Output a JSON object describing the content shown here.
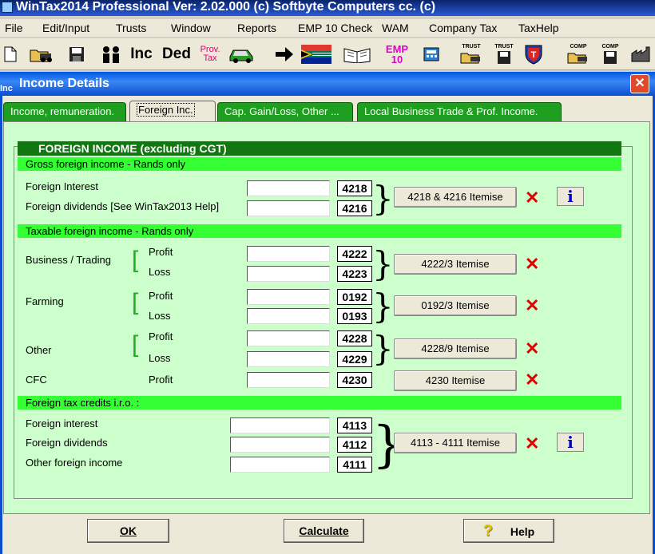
{
  "app": {
    "title": "WinTax2014 Professional Ver: 2.02.000  (c) Softbyte Computers cc.  (c)"
  },
  "menu": [
    "File",
    "Edit/Input",
    "Trusts",
    "Window",
    "Reports",
    "EMP 10 Check",
    "WAM",
    "Company Tax",
    "TaxHelp"
  ],
  "toolbar": {
    "inc_label": "Inc",
    "ded_label": "Ded",
    "prov_label": "Prov.",
    "tax_label": "Tax",
    "emp_label": "EMP",
    "emp_num": "10",
    "trust_label": "TRUST",
    "comp_label": "COMP"
  },
  "dialog": {
    "icon_text": "Inc",
    "title": "Income Details",
    "close_symbol": "✕"
  },
  "tabs": [
    "Income, remuneration.",
    "Foreign Inc.",
    "Cap. Gain/Loss, Other ...",
    "Local Business Trade & Prof. Income."
  ],
  "form": {
    "main_heading": "FOREIGN INCOME (excluding CGT)",
    "gross_heading": "Gross foreign income - Rands only",
    "foreign_interest_label": "Foreign Interest",
    "foreign_dividends_label": "Foreign dividends [See WinTax2013 Help]",
    "code_4218": "4218",
    "code_4216": "4216",
    "btn_4218": "4218 & 4216 Itemise",
    "taxable_heading": "Taxable foreign income - Rands only",
    "business_label": "Business / Trading",
    "farming_label": "Farming",
    "other_label": "Other",
    "cfc_label": "CFC",
    "profit_label": "Profit",
    "loss_label": "Loss",
    "code_4222": "4222",
    "code_4223": "4223",
    "btn_4222": "4222/3 Itemise",
    "code_0192": "0192",
    "code_0193": "0193",
    "btn_0192": "0192/3 Itemise",
    "code_4228": "4228",
    "code_4229": "4229",
    "btn_4228": "4228/9 Itemise",
    "code_4230": "4230",
    "btn_4230": "4230 Itemise",
    "credits_heading": "Foreign tax credits i.r.o. :",
    "credit_interest_label": "Foreign interest",
    "credit_dividends_label": "Foreign dividends",
    "credit_other_label": "Other foreign income",
    "code_4113": "4113",
    "code_4112": "4112",
    "code_4111": "4111",
    "btn_4113": "4113 - 4111   Itemise",
    "delete_symbol": "✕",
    "info_symbol": "i"
  },
  "footer": {
    "ok_label": "OK",
    "calculate_label": "Calculate",
    "help_label": "Help",
    "help_icon": "?"
  },
  "colors": {
    "panel_bg": "#ccffcc",
    "section_header": "#33ff33",
    "main_header": "#117711",
    "tab_green": "#1f9f1f",
    "delete_red": "#e00000"
  }
}
